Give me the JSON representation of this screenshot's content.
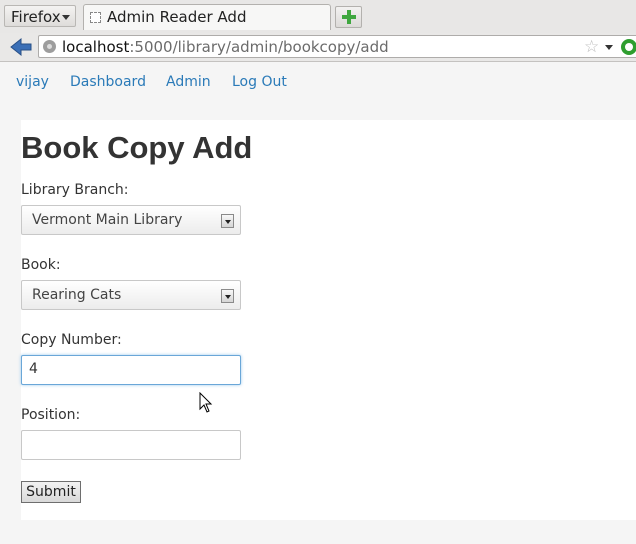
{
  "browser": {
    "menu_label": "Firefox",
    "tab_title": "Admin Reader Add",
    "url_host": "localhost",
    "url_path": ":5000/library/admin/bookcopy/add"
  },
  "nav": {
    "user": "vijay",
    "dashboard": "Dashboard",
    "admin": "Admin",
    "logout": "Log Out"
  },
  "form": {
    "title": "Book Copy Add",
    "branch_label": "Library Branch:",
    "branch_value": "Vermont Main Library",
    "book_label": "Book:",
    "book_value": "Rearing Cats",
    "copy_label": "Copy Number:",
    "copy_value": "4",
    "position_label": "Position:",
    "position_value": "",
    "submit_label": "Submit"
  },
  "colors": {
    "link": "#2a7ab8",
    "focus_border": "#6aa7d8"
  }
}
